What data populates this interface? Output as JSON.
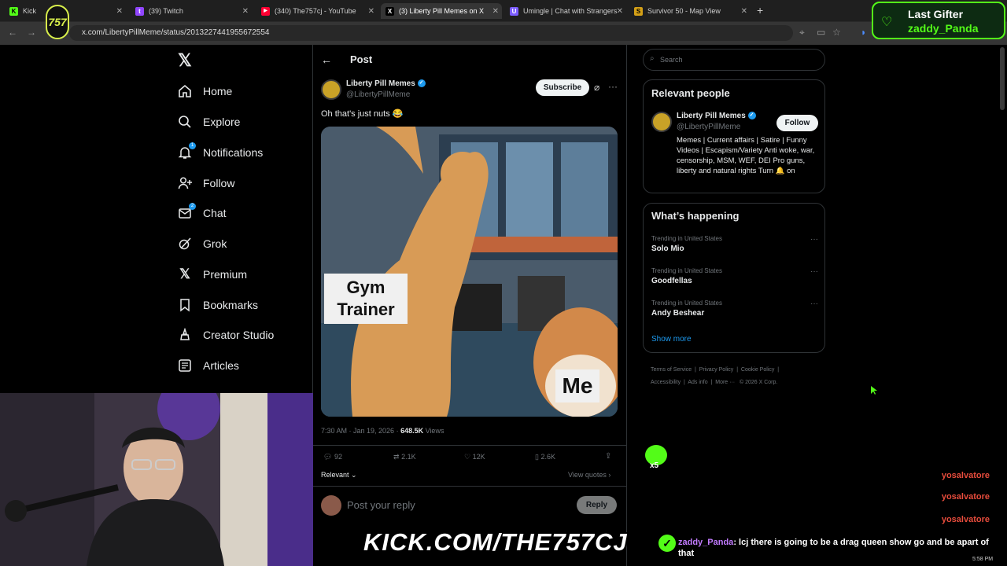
{
  "browser": {
    "tabs": [
      {
        "title": "Kick",
        "color": "#53fc18",
        "glyph": "K"
      },
      {
        "title": "(39) Twitch",
        "color": "#9146ff",
        "glyph": "t"
      },
      {
        "title": "(340) The757cj - YouTube",
        "color": "#ff0033",
        "glyph": "▶"
      },
      {
        "title": "(3) Liberty Pill Memes on X",
        "color": "#ffffff",
        "glyph": "X"
      },
      {
        "title": "Umingle | Chat with Strangers",
        "color": "#7b5cff",
        "glyph": "U"
      },
      {
        "title": "Survivor 50 - Map View",
        "color": "#d4a017",
        "glyph": "S"
      }
    ],
    "url": "x.com/LibertyPillMeme/status/2013227441955672554"
  },
  "nav": {
    "items": [
      {
        "label": "Home",
        "icon": "home-icon"
      },
      {
        "label": "Explore",
        "icon": "search-icon"
      },
      {
        "label": "Notifications",
        "icon": "bell-icon",
        "badge": "1"
      },
      {
        "label": "Follow",
        "icon": "add-person-icon"
      },
      {
        "label": "Chat",
        "icon": "mail-icon",
        "badge": "2"
      },
      {
        "label": "Grok",
        "icon": "grok-icon"
      },
      {
        "label": "Premium",
        "icon": "x-logo-icon"
      },
      {
        "label": "Bookmarks",
        "icon": "bookmark-icon"
      },
      {
        "label": "Creator Studio",
        "icon": "creator-icon"
      },
      {
        "label": "Articles",
        "icon": "articles-icon"
      }
    ]
  },
  "post": {
    "header_title": "Post",
    "author_name": "Liberty Pill Memes",
    "author_handle": "@LibertyPillMeme",
    "subscribe_label": "Subscribe",
    "text": "Oh that's just nuts 😂",
    "meme_label_left": "Gym\nTrainer",
    "meme_label_right": "Me",
    "timestamp": "7:30 AM · Jan 19, 2026 · ",
    "views_count": "648.5K",
    "views_label": " Views",
    "stats": {
      "replies": "92",
      "reposts": "2.1K",
      "likes": "12K",
      "bookmarks": "2.6K"
    },
    "relevant_label": "Relevant ⌄",
    "view_quotes": "View quotes ›",
    "reply_placeholder": "Post your reply",
    "reply_button": "Reply"
  },
  "sidebar": {
    "search_placeholder": "Search",
    "relevant_people_title": "Relevant people",
    "person_name": "Liberty Pill Memes",
    "person_handle": "@LibertyPillMeme",
    "follow_label": "Follow",
    "person_bio": "Memes | Current affairs | Satire | Funny Videos | Escapism/Variety Anti woke, war, censorship, MSM, WEF, DEI Pro guns, liberty and natural rights Turn 🔔 on",
    "happening_title": "What’s happening",
    "trends": [
      {
        "context": "Trending in United States",
        "name": "Solo Mio"
      },
      {
        "context": "Trending in United States",
        "name": "Goodfellas"
      },
      {
        "context": "Trending in United States",
        "name": "Andy Beshear"
      }
    ],
    "show_more": "Show more",
    "footer_links": [
      "Terms of Service",
      "Privacy Policy",
      "Cookie Policy",
      "Accessibility",
      "Ads info",
      "More ···",
      "© 2026 X Corp."
    ]
  },
  "stream": {
    "last_gifter_label": "Last Gifter",
    "last_gifter_name": "zaddy_Panda",
    "kick_banner": "KICK.COM/THE757CJ",
    "chat_user_1": "yosalvatore",
    "chat_user_2": "yosalvatore",
    "chat_user_3": "yosalvatore",
    "chat_message_user": "zaddy_Panda",
    "chat_message_text": ": lcj there is going to be a drag queen show go and be apart of that",
    "emote_count": "x5",
    "clock": "5:58 PM"
  }
}
